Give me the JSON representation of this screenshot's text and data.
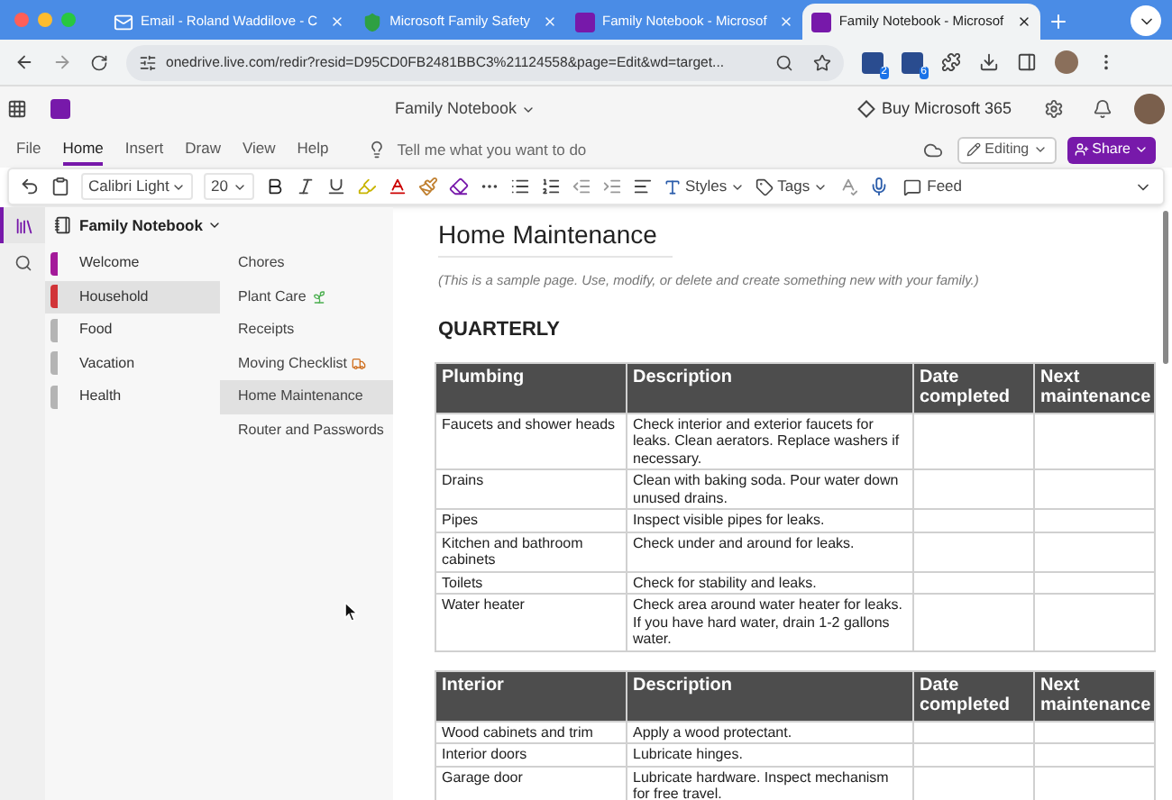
{
  "browser": {
    "tabs": [
      {
        "title": "Email - Roland Waddilove - C",
        "kind": "mail",
        "selected": false
      },
      {
        "title": "Microsoft Family Safety",
        "kind": "shield",
        "selected": false
      },
      {
        "title": "Family Notebook - Microsof",
        "kind": "onenote",
        "selected": false
      },
      {
        "title": "Family Notebook - Microsof",
        "kind": "onenote",
        "selected": true
      }
    ],
    "url": "onedrive.live.com/redir?resid=D95CD0FB2481BBC3%21124558&page=Edit&wd=target...",
    "extension_badges": [
      "2",
      "6"
    ]
  },
  "app": {
    "title": "Family Notebook",
    "buy_label": "Buy Microsoft 365"
  },
  "ribbon_tabs": [
    {
      "label": "File",
      "selected": false
    },
    {
      "label": "Home",
      "selected": true
    },
    {
      "label": "Insert",
      "selected": false
    },
    {
      "label": "Draw",
      "selected": false
    },
    {
      "label": "View",
      "selected": false
    },
    {
      "label": "Help",
      "selected": false
    }
  ],
  "tell_me": {
    "placeholder": "Tell me what you want to do"
  },
  "mode": {
    "label": "Editing"
  },
  "share": {
    "label": "Share"
  },
  "toolbar": {
    "font": "Calibri Light",
    "size": "20",
    "styles": "Styles",
    "tags": "Tags",
    "feed": "Feed"
  },
  "notebook": {
    "title": "Family Notebook"
  },
  "sections": [
    {
      "name": "Welcome",
      "color": "#a4199a",
      "selected": false
    },
    {
      "name": "Household",
      "color": "#d13438",
      "selected": true
    },
    {
      "name": "Food",
      "color": "#b4b4b4",
      "selected": false
    },
    {
      "name": "Vacation",
      "color": "#b4b4b4",
      "selected": false
    },
    {
      "name": "Health",
      "color": "#b4b4b4",
      "selected": false
    }
  ],
  "pages": [
    {
      "title": "Chores",
      "kind": "plain",
      "selected": false
    },
    {
      "title": "Plant Care",
      "kind": "plant",
      "selected": false
    },
    {
      "title": "Receipts",
      "kind": "plain",
      "selected": false
    },
    {
      "title": "Moving Checklist",
      "kind": "truck",
      "selected": false
    },
    {
      "title": "Home Maintenance",
      "kind": "plain",
      "selected": true
    },
    {
      "title": "Router and Passwords",
      "kind": "plain",
      "selected": false
    }
  ],
  "page": {
    "title": "Home Maintenance",
    "note": "(This is a sample page. Use, modify, or delete and create something new with your family.)",
    "heading": "QUARTERLY",
    "tables": [
      {
        "columns": [
          "Plumbing",
          "Description",
          "Date completed",
          "Next maintenance"
        ],
        "rows": [
          [
            "Faucets and shower heads",
            "Check interior and exterior faucets for leaks. Clean aerators. Replace washers if necessary."
          ],
          [
            "Drains",
            "Clean with baking soda. Pour water down unused drains."
          ],
          [
            "Pipes",
            "Inspect visible pipes for leaks."
          ],
          [
            "Kitchen and bathroom cabinets",
            "Check under and around for leaks."
          ],
          [
            "Toilets",
            "Check for stability and leaks."
          ],
          [
            "Water heater",
            "Check area around water heater for leaks. If you have hard water, drain 1-2 gallons water."
          ]
        ]
      },
      {
        "columns": [
          "Interior",
          "Description",
          "Date completed",
          "Next maintenance"
        ],
        "rows": [
          [
            "Wood cabinets and trim",
            "Apply a wood protectant."
          ],
          [
            "Interior doors",
            "Lubricate hinges."
          ],
          [
            "Garage door",
            "Lubricate hardware. Inspect mechanism for free travel."
          ]
        ]
      }
    ]
  }
}
